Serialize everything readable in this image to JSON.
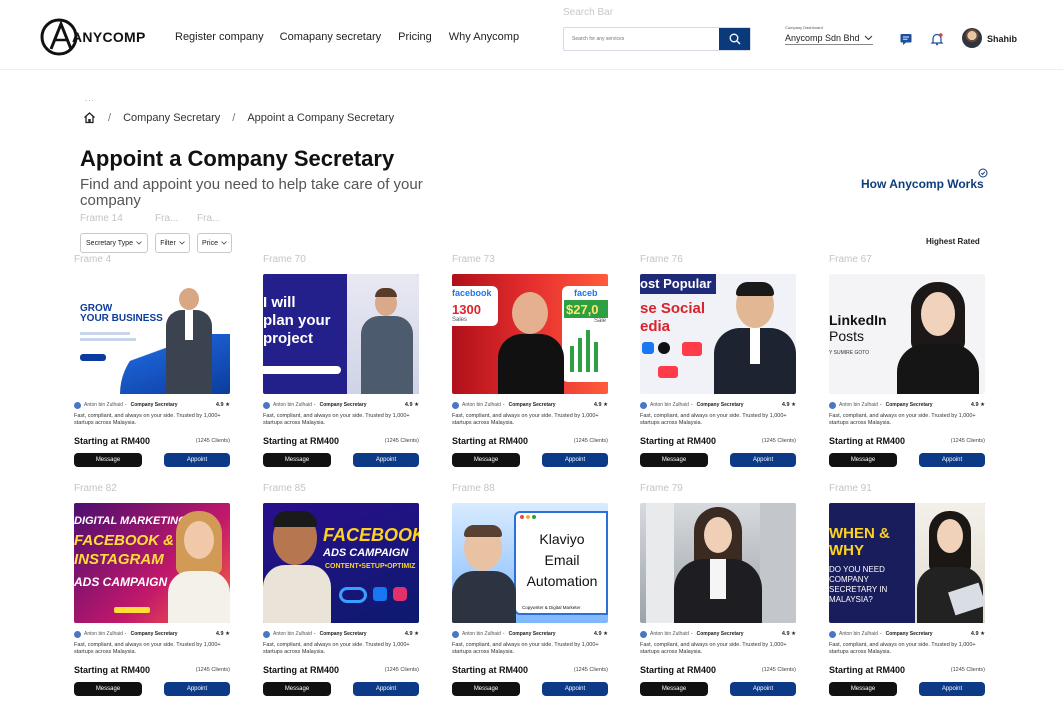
{
  "header": {
    "brand": "ANYCOMP",
    "nav": [
      "Register company",
      "Comapany secretary",
      "Pricing",
      "Why Anycomp"
    ],
    "search_caption": "Search Bar",
    "search_placeholder": "Search for any services",
    "company_caption": "Company Dashboard",
    "company_name": "Anycomp Sdn Bhd",
    "user_name": "Shahib",
    "icons": [
      "anycomp-logo",
      "search-icon",
      "chevron-down-icon",
      "message-icon",
      "bell-icon",
      "avatar"
    ],
    "colors": {
      "brand_navy": "#0d3a86",
      "search_button": "#0a3a7a",
      "notification_dot": "#e53935"
    }
  },
  "breadcrumb": {
    "dots": "...",
    "items": [
      "Company Secretary",
      "Appoint a Company Secretary"
    ]
  },
  "page": {
    "title": "Appoint a Company Secretary",
    "subtitle": "Find and appoint you need to help take care of your company",
    "how_works": "How Anycomp Works"
  },
  "frame_labels": {
    "filters": [
      "Frame 14",
      "Fra...",
      "Fra..."
    ]
  },
  "filters": {
    "items": [
      "Secretary Type",
      "Filter",
      "Price"
    ],
    "sort": "Highest Rated"
  },
  "cards": [
    {
      "frame": "Frame 4",
      "name": "Anton bin Zulhaid",
      "role": "Company Secretary",
      "rating": "4.9",
      "desc": "Fast, compliant, and always on your side. Trusted by 1,000+ startups across Malaysia.",
      "price": "Starting at RM400",
      "clients": "(1245 Clients)",
      "msg": "Message",
      "appoint": "Appoint",
      "art": {
        "lines": [
          "GROW",
          "YOUR BUSINESS"
        ]
      }
    },
    {
      "frame": "Frame 70",
      "name": "Anton bin Zulhaid",
      "role": "Company Secretary",
      "rating": "4.9",
      "desc": "Fast, compliant, and always on your side. Trusted by 1,000+ startups across Malaysia.",
      "price": "Starting at RM400",
      "clients": "(1245 Clients)",
      "msg": "Message",
      "appoint": "Appoint",
      "art": {
        "lines": [
          "I will",
          "plan your",
          "project"
        ]
      }
    },
    {
      "frame": "Frame 73",
      "name": "Anton bin Zulhaid",
      "role": "Company Secretary",
      "rating": "4.9",
      "desc": "Fast, compliant, and always on your side. Trusted by 1,000+ startups across Malaysia.",
      "price": "Starting at RM400",
      "clients": "(1245 Clients)",
      "msg": "Message",
      "appoint": "Appoint",
      "art": {
        "lines": [
          "facebook",
          "1300",
          "Sales",
          "$27,0",
          "faceb",
          "Sale"
        ]
      }
    },
    {
      "frame": "Frame 76",
      "name": "Anton bin Zulhaid",
      "role": "Company Secretary",
      "rating": "4.9",
      "desc": "Fast, compliant, and always on your side. Trusted by 1,000+ startups across Malaysia.",
      "price": "Starting at RM400",
      "clients": "(1245 Clients)",
      "msg": "Message",
      "appoint": "Appoint",
      "art": {
        "lines": [
          "ost Popular",
          "se Social",
          "edia"
        ]
      }
    },
    {
      "frame": "Frame 67",
      "name": "Anton bin Zulhaid",
      "role": "Company Secretary",
      "rating": "4.9",
      "desc": "Fast, compliant, and always on your side. Trusted by 1,000+ startups across Malaysia.",
      "price": "Starting at RM400",
      "clients": "(1245 Clients)",
      "msg": "Message",
      "appoint": "Appoint",
      "art": {
        "lines": [
          "LinkedIn",
          "Posts",
          "Y SUMIRE GOTO"
        ]
      }
    },
    {
      "frame": "Frame 82",
      "name": "Anton bin Zulhaid",
      "role": "Company Secretary",
      "rating": "4.9",
      "desc": "Fast, compliant, and always on your side. Trusted by 1,000+ startups across Malaysia.",
      "price": "Starting at RM400",
      "clients": "(1245 Clients)",
      "msg": "Message",
      "appoint": "Appoint",
      "art": {
        "lines": [
          "DIGITAL MARKETING",
          "FACEBOOK &",
          "INSTAGRAM",
          "ADS CAMPAIGN"
        ]
      }
    },
    {
      "frame": "Frame 85",
      "name": "Anton bin Zulhaid",
      "role": "Company Secretary",
      "rating": "4.9",
      "desc": "Fast, compliant, and always on your side. Trusted by 1,000+ startups across Malaysia.",
      "price": "Starting at RM400",
      "clients": "(1245 Clients)",
      "msg": "Message",
      "appoint": "Appoint",
      "art": {
        "lines": [
          "FACEBOOK",
          "ADS CAMPAIGN",
          "CONTENT•SETUP•OPTIMIZ"
        ]
      }
    },
    {
      "frame": "Frame 88",
      "name": "Anton bin Zulhaid",
      "role": "Company Secretary",
      "rating": "4.9",
      "desc": "Fast, compliant, and always on your side. Trusted by 1,000+ startups across Malaysia.",
      "price": "Starting at RM400",
      "clients": "(1245 Clients)",
      "msg": "Message",
      "appoint": "Appoint",
      "art": {
        "lines": [
          "Klaviyo",
          "Email",
          "Automation",
          "Copywriter & Digital Marketer"
        ]
      }
    },
    {
      "frame": "Frame 79",
      "name": "Anton bin Zulhaid",
      "role": "Company Secretary",
      "rating": "4.9",
      "desc": "Fast, compliant, and always on your side. Trusted by 1,000+ startups across Malaysia.",
      "price": "Starting at RM400",
      "clients": "(1245 Clients)",
      "msg": "Message",
      "appoint": "Appoint",
      "art": {
        "lines": []
      }
    },
    {
      "frame": "Frame 91",
      "name": "Anton bin Zulhaid",
      "role": "Company Secretary",
      "rating": "4.9",
      "desc": "Fast, compliant, and always on your side. Trusted by 1,000+ startups across Malaysia.",
      "price": "Starting at RM400",
      "clients": "(1245 Clients)",
      "msg": "Message",
      "appoint": "Appoint",
      "art": {
        "lines": [
          "WHEN &",
          "WHY",
          "DO YOU NEED",
          "COMPANY",
          "SECRETARY IN",
          "MALAYSIA?"
        ]
      }
    }
  ]
}
